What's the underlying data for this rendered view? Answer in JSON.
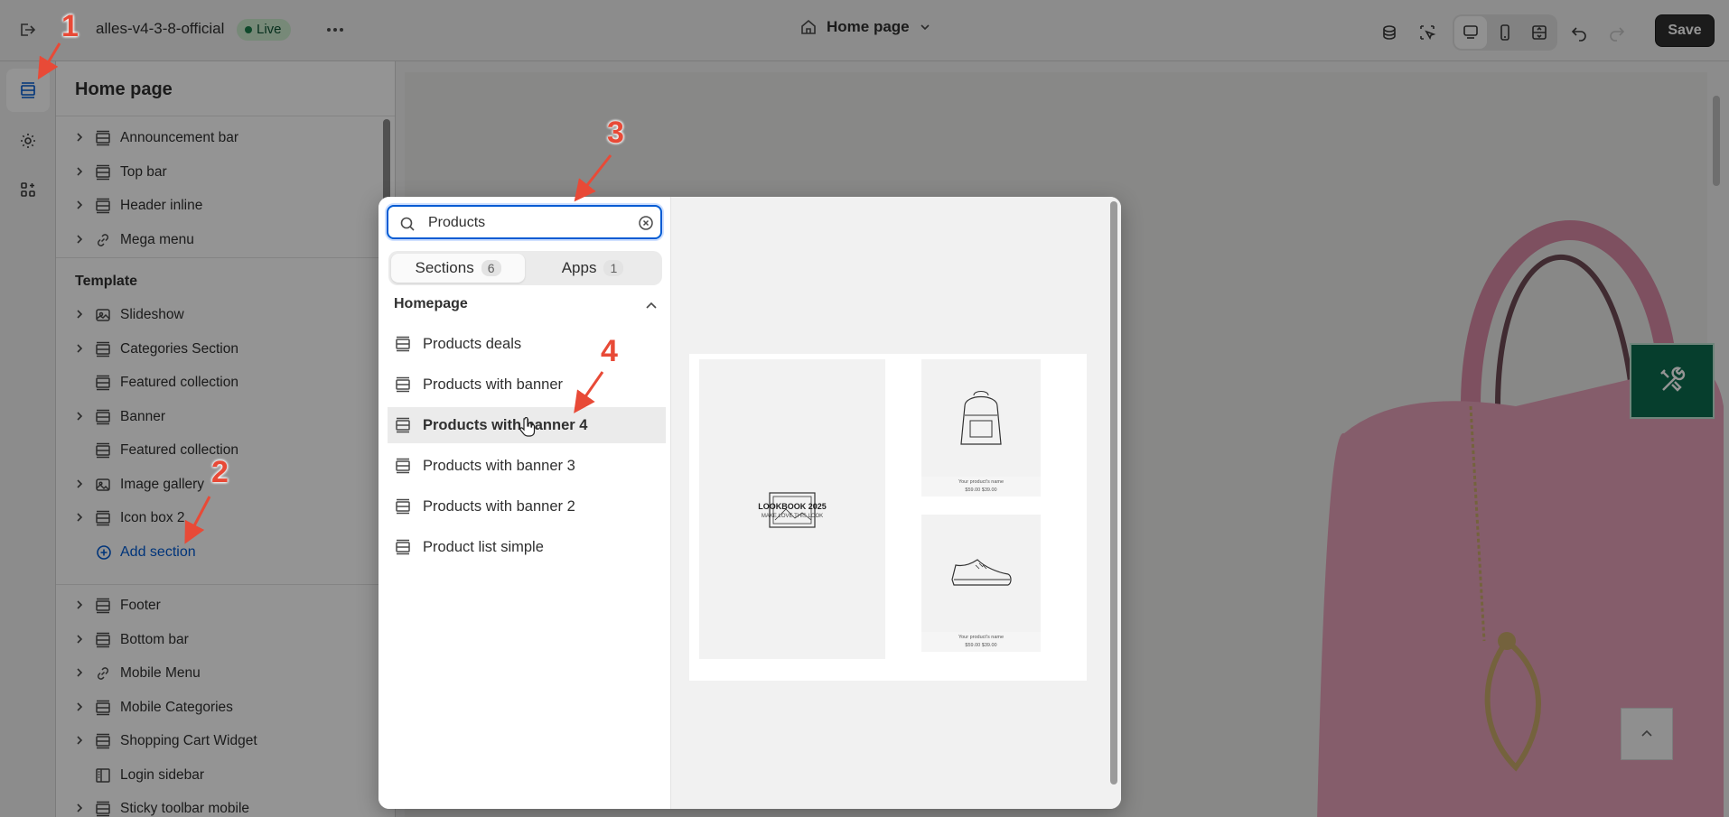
{
  "topbar": {
    "store_name": "alles-v4-3-8-official",
    "status": "Live",
    "page_selector": "Home page",
    "save_label": "Save"
  },
  "sidebar": {
    "title": "Home page",
    "header_sections": [
      {
        "label": "Announcement bar",
        "icon": "section-icon",
        "expandable": true
      },
      {
        "label": "Top bar",
        "icon": "section-icon",
        "expandable": true
      },
      {
        "label": "Header inline",
        "icon": "section-icon",
        "expandable": true
      },
      {
        "label": "Mega menu",
        "icon": "link-icon",
        "expandable": true
      }
    ],
    "template_title": "Template",
    "template_sections": [
      {
        "label": "Slideshow",
        "icon": "slideshow-icon",
        "expandable": true
      },
      {
        "label": "Categories Section",
        "icon": "section-icon",
        "expandable": true
      },
      {
        "label": "Featured collection",
        "icon": "section-icon",
        "expandable": false
      },
      {
        "label": "Banner",
        "icon": "section-icon",
        "expandable": true
      },
      {
        "label": "Featured collection",
        "icon": "section-icon",
        "expandable": false
      },
      {
        "label": "Image gallery",
        "icon": "image-icon",
        "expandable": true
      },
      {
        "label": "Icon box 2",
        "icon": "section-icon",
        "expandable": true
      }
    ],
    "add_section_label": "Add section",
    "footer_sections": [
      {
        "label": "Footer",
        "icon": "section-icon",
        "expandable": true
      },
      {
        "label": "Bottom bar",
        "icon": "section-icon",
        "expandable": true
      },
      {
        "label": "Mobile Menu",
        "icon": "link-icon",
        "expandable": true
      },
      {
        "label": "Mobile Categories",
        "icon": "section-icon",
        "expandable": true
      },
      {
        "label": "Shopping Cart Widget",
        "icon": "section-icon",
        "expandable": true
      },
      {
        "label": "Login sidebar",
        "icon": "sidebar-icon",
        "expandable": false
      },
      {
        "label": "Sticky toolbar mobile",
        "icon": "section-icon",
        "expandable": true
      }
    ]
  },
  "popover": {
    "search_value": "Products",
    "tabs": [
      {
        "label": "Sections",
        "count": "6",
        "active": true
      },
      {
        "label": "Apps",
        "count": "1",
        "active": false
      }
    ],
    "category": "Homepage",
    "results": [
      {
        "label": "Products deals"
      },
      {
        "label": "Products with banner"
      },
      {
        "label": "Products with banner 4",
        "hovered": true
      },
      {
        "label": "Products with banner 3"
      },
      {
        "label": "Products with banner 2"
      },
      {
        "label": "Product list simple"
      }
    ],
    "preview": {
      "lookbook_title": "LOOKBOOK 2025",
      "lookbook_sub": "MAKE LOVE THIS LOOK",
      "product_name": "Your product's name",
      "product_price": "$59.00  $39.00"
    }
  },
  "annotations": [
    "1",
    "2",
    "3",
    "4"
  ],
  "colors": {
    "accent": "#005bd3",
    "live_badge": "#cdeccf",
    "annotation": "#e84a37",
    "preview_tool": "#0b6b4f"
  }
}
